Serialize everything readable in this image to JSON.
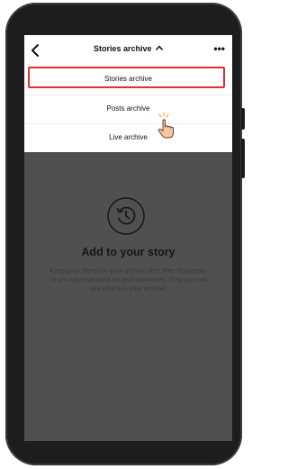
{
  "header": {
    "title": "Stories archive",
    "back_icon": "chevron-left-icon",
    "dropdown_icon": "chevron-up-icon",
    "more_icon": "more-horizontal-icon",
    "more_glyph": "•••"
  },
  "menu": {
    "items": [
      {
        "label": "Stories archive",
        "selected": true
      },
      {
        "label": "Posts archive",
        "selected": false
      },
      {
        "label": "Live archive",
        "selected": false
      }
    ],
    "highlight_color": "#e03131"
  },
  "empty_state": {
    "icon": "history-clock-icon",
    "title": "Add to your story",
    "description": "Keep your stories in your archive after they disappear, so you can look back on your memories. Only you can see what's in your archive."
  },
  "colors": {
    "phone_frame": "#1d1d1d",
    "overlay": "#505050",
    "menu_background": "#ffffff"
  }
}
